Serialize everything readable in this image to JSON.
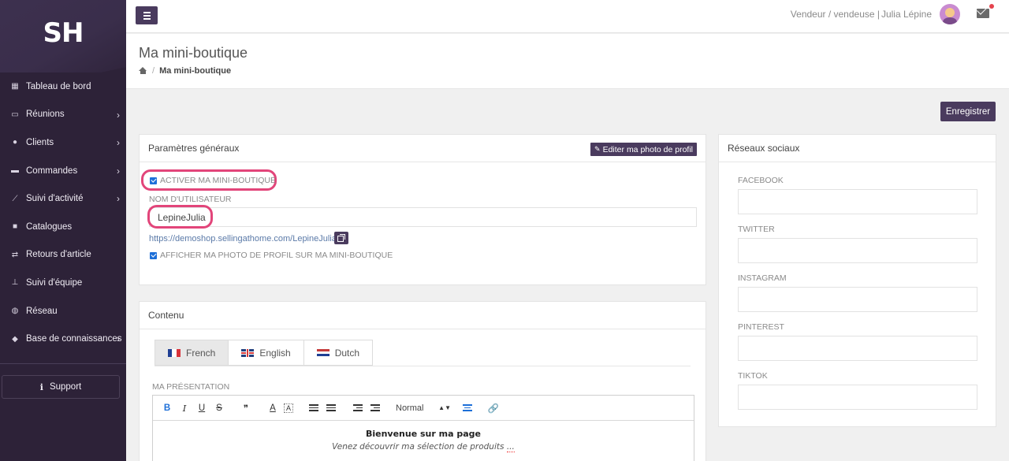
{
  "sidebar": {
    "logo": "SH",
    "items": [
      {
        "label": "Tableau de bord",
        "icon": "dashboard-icon",
        "chevron": false
      },
      {
        "label": "Réunions",
        "icon": "calendar-icon",
        "chevron": true
      },
      {
        "label": "Clients",
        "icon": "users-icon",
        "chevron": true
      },
      {
        "label": "Commandes",
        "icon": "credit-card-icon",
        "chevron": true
      },
      {
        "label": "Suivi d'activité",
        "icon": "line-chart-icon",
        "chevron": true
      },
      {
        "label": "Catalogues",
        "icon": "book-icon",
        "chevron": false
      },
      {
        "label": "Retours d'article",
        "icon": "exchange-icon",
        "chevron": false
      },
      {
        "label": "Suivi d'équipe",
        "icon": "sitemap-icon",
        "chevron": false
      },
      {
        "label": "Réseau",
        "icon": "globe-icon",
        "chevron": false
      },
      {
        "label": "Base de connaissances",
        "icon": "graduation-cap-icon",
        "chevron": true
      }
    ],
    "support_label": "Support"
  },
  "topbar": {
    "role": "Vendeur / vendeuse |",
    "user_name": "Julia Lépine"
  },
  "page": {
    "title": "Ma mini-boutique",
    "breadcrumb_current": "Ma mini-boutique",
    "breadcrumb_sep": "/",
    "save_label": "Enregistrer"
  },
  "general": {
    "title": "Paramètres généraux",
    "edit_photo_label": "Editer ma photo de profil",
    "activate_label": "ACTIVER MA MINI-BOUTIQUE",
    "username_label": "NOM D'UTILISATEUR",
    "username_value": "LepineJulia",
    "shop_url": "https://demoshop.sellingathome.com/LepineJulia",
    "show_photo_label": "AFFICHER MA PHOTO DE PROFIL SUR MA MINI-BOUTIQUE"
  },
  "content": {
    "title": "Contenu",
    "tabs": [
      "French",
      "English",
      "Dutch"
    ],
    "active_tab": "French",
    "presentation_label": "MA PRÉSENTATION",
    "toolbar": {
      "bold": "B",
      "italic": "I",
      "underline": "U",
      "strike": "S",
      "quote": "❞",
      "font_color": "A",
      "bg_color": "A",
      "format_select": "Normal"
    },
    "editor_title": "Bienvenue sur ma page",
    "editor_subtitle_main": "Venez découvrir ma sélection de produits",
    "editor_subtitle_tail": "..."
  },
  "social": {
    "title": "Réseaux sociaux",
    "fields": [
      "FACEBOOK",
      "TWITTER",
      "INSTAGRAM",
      "PINTEREST",
      "TIKTOK"
    ]
  }
}
